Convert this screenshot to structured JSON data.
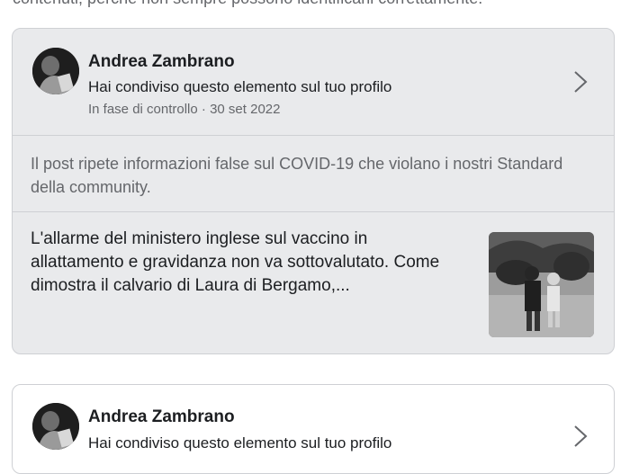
{
  "top": {
    "text": "contenuti, perché non sempre possono identificarli correttamente."
  },
  "cards": [
    {
      "author": "Andrea Zambrano",
      "action": "Hai condiviso questo elemento sul tuo profilo",
      "status": "In fase di controllo · 30 set 2022",
      "violation": "Il post ripete informazioni false sul COVID-19 che violano i nostri Standard della community.",
      "post_text": "L'allarme del ministero inglese sul vaccino in allattamento e gravidanza non va sottovalutato. Come dimostra il calvario di Laura di Bergamo,..."
    },
    {
      "author": "Andrea Zambrano",
      "action": "Hai condiviso questo elemento sul tuo profilo"
    }
  ],
  "icons": {
    "chevron": "chevron-right-icon",
    "avatar": "avatar-photo",
    "thumbnail": "post-thumbnail-photo"
  },
  "colors": {
    "card_grey": "#e9eaec",
    "secondary_text": "#65676b",
    "border": "#ced0d4"
  }
}
